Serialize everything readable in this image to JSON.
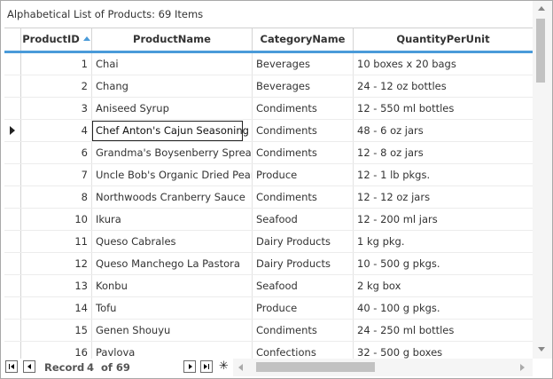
{
  "caption": "Alphabetical List of Products: 69 Items",
  "columns": {
    "product_id": "ProductID",
    "product_name": "ProductName",
    "category_name": "CategoryName",
    "quantity_per_unit": "QuantityPerUnit"
  },
  "sort": {
    "column": "ProductID",
    "direction": "ascending"
  },
  "current_row_index": 3,
  "rows": [
    {
      "id": "1",
      "name": "Chai",
      "category": "Beverages",
      "qty": "10 boxes x 20 bags"
    },
    {
      "id": "2",
      "name": "Chang",
      "category": "Beverages",
      "qty": "24 - 12 oz bottles"
    },
    {
      "id": "3",
      "name": "Aniseed Syrup",
      "category": "Condiments",
      "qty": "12 - 550 ml bottles"
    },
    {
      "id": "4",
      "name": "Chef Anton's Cajun Seasoning",
      "category": "Condiments",
      "qty": "48 - 6 oz jars"
    },
    {
      "id": "6",
      "name": "Grandma's Boysenberry Spread",
      "category": "Condiments",
      "qty": "12 - 8 oz jars"
    },
    {
      "id": "7",
      "name": "Uncle Bob's Organic Dried Pears",
      "category": "Produce",
      "qty": "12 - 1 lb pkgs."
    },
    {
      "id": "8",
      "name": "Northwoods Cranberry Sauce",
      "category": "Condiments",
      "qty": "12 - 12 oz jars"
    },
    {
      "id": "10",
      "name": "Ikura",
      "category": "Seafood",
      "qty": "12 - 200 ml jars"
    },
    {
      "id": "11",
      "name": "Queso Cabrales",
      "category": "Dairy Products",
      "qty": "1 kg pkg."
    },
    {
      "id": "12",
      "name": "Queso Manchego La Pastora",
      "category": "Dairy Products",
      "qty": "10 - 500 g pkgs."
    },
    {
      "id": "13",
      "name": "Konbu",
      "category": "Seafood",
      "qty": "2 kg box"
    },
    {
      "id": "14",
      "name": "Tofu",
      "category": "Produce",
      "qty": "40 - 100 g pkgs."
    },
    {
      "id": "15",
      "name": "Genen Shouyu",
      "category": "Condiments",
      "qty": "24 - 250 ml bottles"
    },
    {
      "id": "16",
      "name": "Pavlova",
      "category": "Confections",
      "qty": "32 - 500 g boxes"
    }
  ],
  "navigator": {
    "record_label": "Record",
    "current": "4",
    "of_text": "of 69",
    "first_icon": "first-record-icon",
    "prev_icon": "previous-record-icon",
    "next_icon": "next-record-icon",
    "last_icon": "last-record-icon",
    "new_icon": "new-record-icon"
  },
  "colors": {
    "accent": "#4a9bd9",
    "border": "#a9a9a9",
    "text": "#333333"
  }
}
